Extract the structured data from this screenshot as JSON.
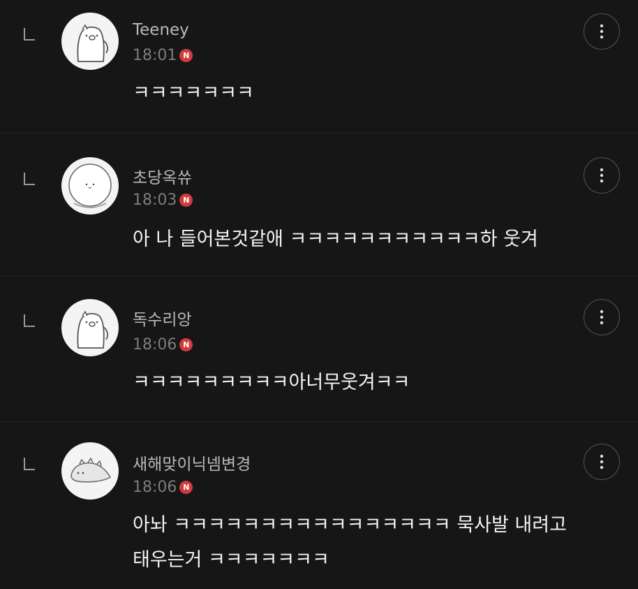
{
  "comments": [
    {
      "nickname": "Teeney",
      "time": "18:01",
      "badge": "N",
      "avatar": "pig-character-avatar",
      "text": "ㅋㅋㅋㅋㅋㅋㅋ"
    },
    {
      "nickname": "초당옥쓔",
      "time": "18:03",
      "badge": "N",
      "avatar": "round-character-avatar",
      "text": "아 나 들어본것같애 ㅋㅋㅋㅋㅋㅋㅋㅋㅋㅋㅋ하 웃겨"
    },
    {
      "nickname": "독수리앙",
      "time": "18:06",
      "badge": "N",
      "avatar": "pig-character-avatar",
      "text": "ㅋㅋㅋㅋㅋㅋㅋㅋㅋ아너무웃겨ㅋㅋ"
    },
    {
      "nickname": "새해맞이닉넴변경",
      "time": "18:06",
      "badge": "N",
      "avatar": "dinosaur-character-avatar",
      "text": "아놔 ㅋㅋㅋㅋㅋㅋㅋㅋㅋㅋㅋㅋㅋㅋㅋㅋ 묵사발 내려고\n태우는거 ㅋㅋㅋㅋㅋㅋㅋ"
    }
  ],
  "colors": {
    "background": "#161616",
    "badge": "#d23b3b",
    "nickname": "#b9b9b9",
    "time": "#7c7c7c",
    "text": "#f4f4f4"
  }
}
